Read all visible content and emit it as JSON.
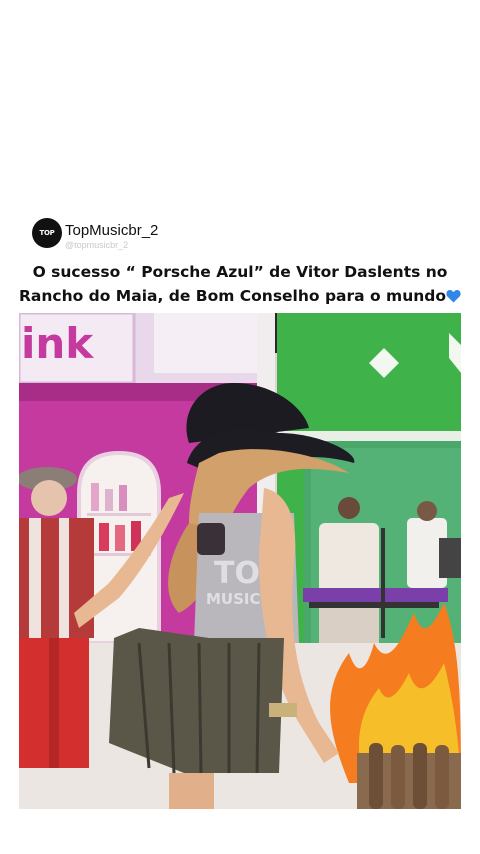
{
  "post": {
    "account_name": "TopMusicbr_2",
    "account_handle": "@topmusicbr_2",
    "avatar_text": "TOP",
    "caption": "O sucesso “ Porsche Azul” de Vitor Daslents no Rancho do Maia, de Bom Conselho para o mundo",
    "caption_emoji": "blue-heart-icon"
  },
  "video": {
    "sign_text": "ink",
    "watermark_line1": "TOP",
    "watermark_line2": "MUSICBR"
  },
  "colors": {
    "background": "#ffffff",
    "text": "#111111",
    "handle": "#c8c8c8",
    "heart": "#2f87e8",
    "stage_pink": "#c53a9e",
    "stage_green": "#3fb34a",
    "flame": "#f57c1f"
  }
}
